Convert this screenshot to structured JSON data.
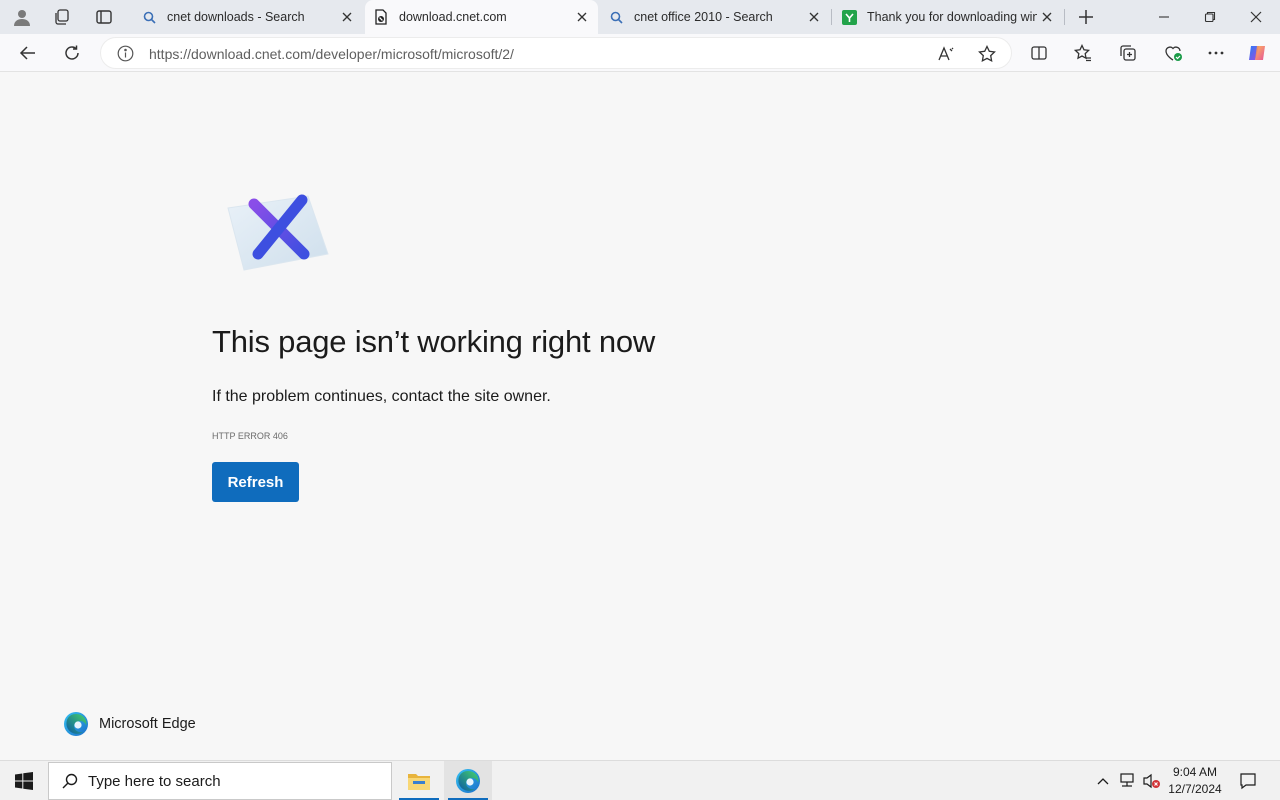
{
  "browser": {
    "tabs": [
      {
        "title": "cnet downloads - Search",
        "favicon": "search-icon",
        "active": false
      },
      {
        "title": "download.cnet.com",
        "favicon": "broken-page-icon",
        "active": true
      },
      {
        "title": "cnet office 2010 - Search",
        "favicon": "search-icon",
        "active": false
      },
      {
        "title": "Thank you for downloading windows",
        "favicon": "green-site-icon",
        "active": false
      }
    ],
    "address_url": "https://download.cnet.com/developer/microsoft/microsoft/2/"
  },
  "error_page": {
    "heading": "This page isn’t working right now",
    "subtext": "If the problem continues, contact the site owner.",
    "error_code": "HTTP ERROR 406",
    "refresh_label": "Refresh",
    "brand_label": "Microsoft Edge"
  },
  "taskbar": {
    "search_placeholder": "Type here to search",
    "time": "9:04 AM",
    "date": "12/7/2024"
  },
  "colors": {
    "accent": "#0f6cbd",
    "page_background": "#f7f7f7",
    "tabstrip_background": "#e6e9ee"
  }
}
